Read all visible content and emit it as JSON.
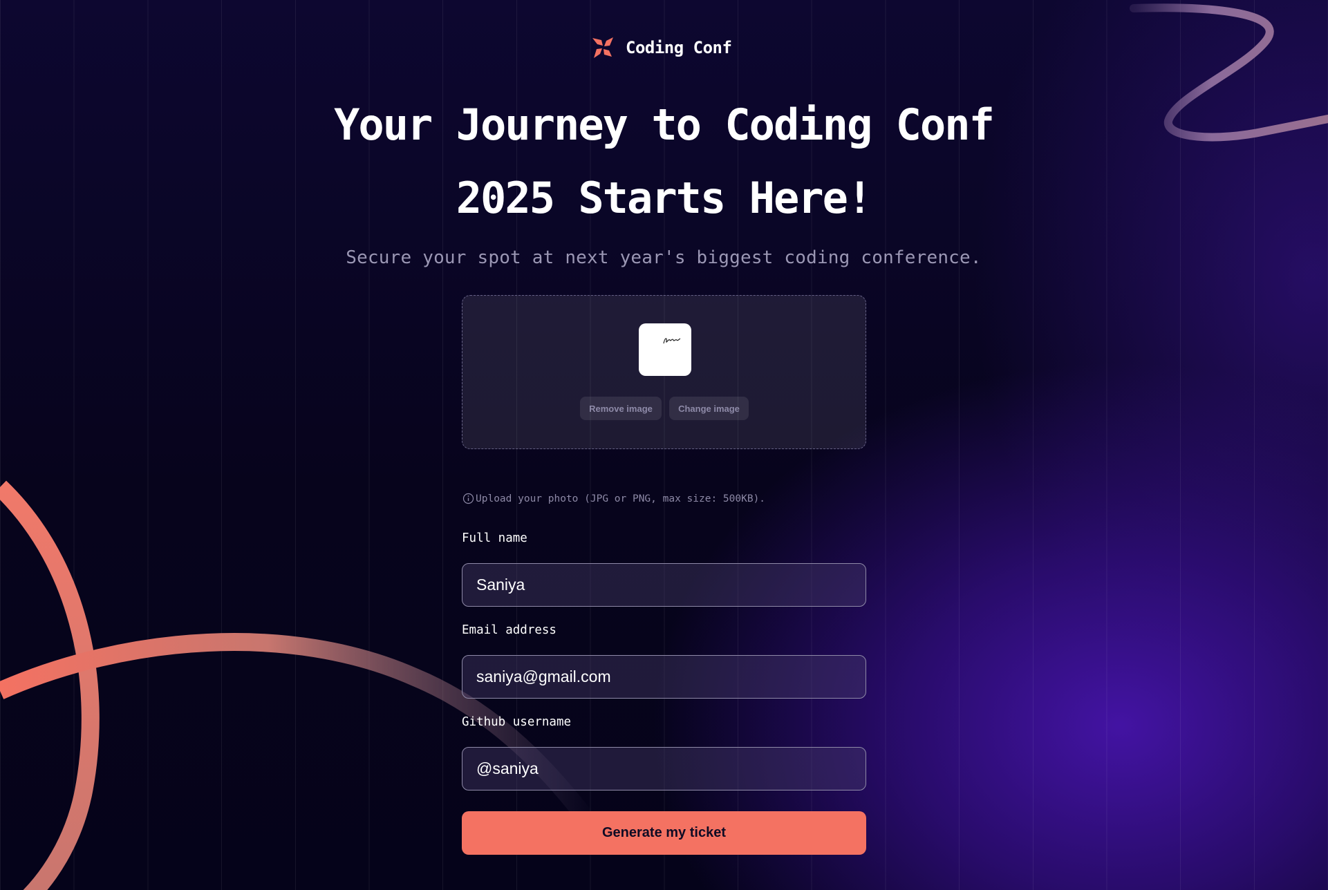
{
  "brand": {
    "name": "Coding Conf",
    "accent_color": "#f47262"
  },
  "hero": {
    "title_line1": "Your Journey to Coding Conf",
    "title_line2": "2025 Starts Here!",
    "subtitle": "Secure your spot at next year's biggest coding conference."
  },
  "upload": {
    "remove_label": "Remove image",
    "change_label": "Change image",
    "hint": "Upload your photo (JPG or PNG, max size: 500KB).",
    "hint_icon": "info-icon"
  },
  "form": {
    "full_name": {
      "label": "Full name",
      "value": "Saniya"
    },
    "email": {
      "label": "Email address",
      "value": "saniya@gmail.com"
    },
    "github": {
      "label": "Github username",
      "value": "@saniya"
    },
    "submit_label": "Generate my ticket"
  }
}
